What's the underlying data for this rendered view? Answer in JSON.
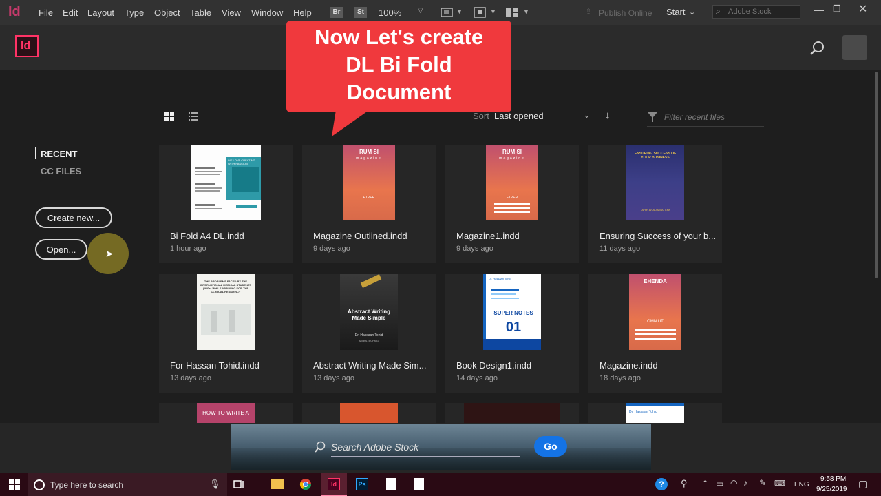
{
  "menubar": {
    "app_logo": "Id",
    "items": [
      "File",
      "Edit",
      "Layout",
      "Type",
      "Object",
      "Table",
      "View",
      "Window",
      "Help"
    ],
    "bridge": "Br",
    "stock": "St",
    "zoom": "100%",
    "publish": "Publish Online",
    "workspace": "Start",
    "search_placeholder": "Adobe Stock"
  },
  "header": {
    "logo": "Id"
  },
  "callout": {
    "line1": "Now Let's create",
    "line2": "DL Bi Fold",
    "line3": "Document"
  },
  "toolbar": {
    "sort_label": "Sort",
    "sort_value": "Last opened",
    "filter_placeholder": "Filter recent files"
  },
  "sidebar": {
    "recent": "RECENT",
    "cc_files": "CC FILES",
    "create_new": "Create new...",
    "open": "Open..."
  },
  "files": [
    {
      "name": "Bi Fold A4 DL.indd",
      "time": "1 hour ago"
    },
    {
      "name": "Magazine Outlined.indd",
      "time": "9 days ago"
    },
    {
      "name": "Magazine1.indd",
      "time": "9 days ago"
    },
    {
      "name": "Ensuring Success of your b...",
      "time": "11 days ago"
    },
    {
      "name": "For Hassan Tohid.indd",
      "time": "13 days ago"
    },
    {
      "name": "Abstract Writing Made Sim...",
      "time": "13 days ago"
    },
    {
      "name": "Book Design1.indd",
      "time": "14 days ago"
    },
    {
      "name": "Magazine.indd",
      "time": "18 days ago"
    }
  ],
  "thumbs": {
    "t1_title": "WE LOVE CREATING WITH PASSION",
    "t2_title": "RUM SI",
    "t2_sub": "magazine",
    "t2_foot": "ETPER",
    "t3_title": "RUM SI",
    "t3_sub": "magazine",
    "t3_foot": "ETPER",
    "t4_title": "ENSURING SUCCESS OF YOUR BUSINESS",
    "t4_foot": "TAHIR AHAD MBA, CPA",
    "t5_title": "THE PROBLEMS FACED BY THE INTERNATIONAL MEDICAL STUDENTS (IMGs) WHILE APPLYING FOR THE CLINICAL RESIDENCY",
    "t6_title": "Abstract Writing Made Simple",
    "t6_author": "Dr. Hassaan Tohid",
    "t6_creds": "MBBS, ECFMG",
    "t7_top": "Dr. Hassaan Tohid",
    "t7_title": "SUPER NOTES",
    "t7_num": "01",
    "t8_title": "EHENDA",
    "t8_foot": "OMN UT",
    "t9_title": "HOW TO WRITE A",
    "t12_top": "Dr. Hassaan Tohid"
  },
  "stock": {
    "placeholder": "Search Adobe Stock",
    "go": "Go"
  },
  "taskbar": {
    "search": "Type here to search",
    "lang": "ENG",
    "time": "9:58 PM",
    "date": "9/25/2019"
  },
  "colors": {
    "indesign": "#ff3366",
    "callout": "#f0393d",
    "accent": "#1473e6",
    "taskbar": "#2a0a14"
  }
}
